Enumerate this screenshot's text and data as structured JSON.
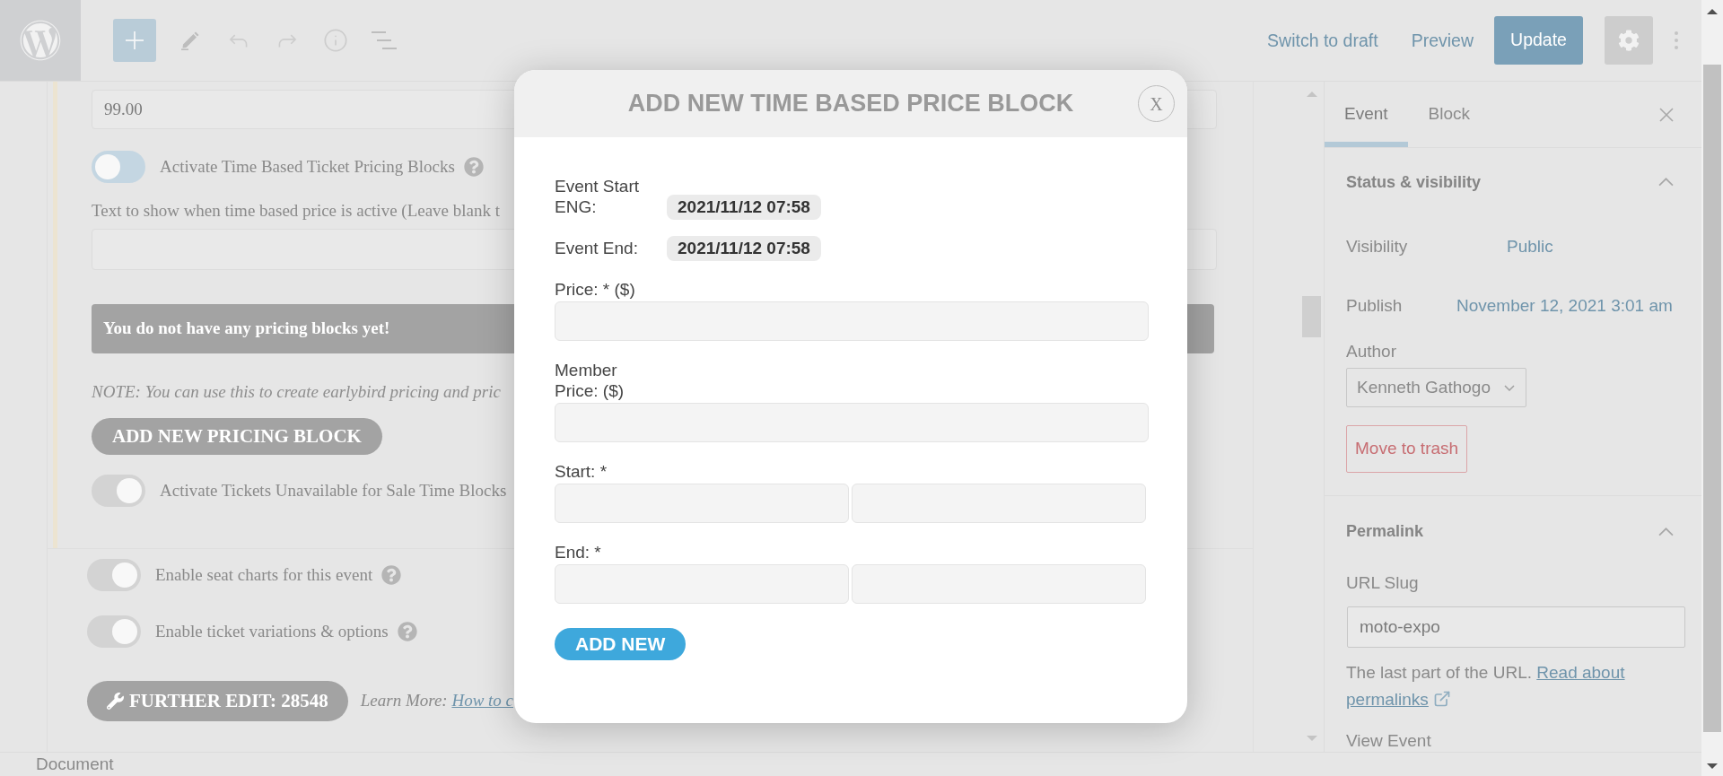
{
  "top_bar": {
    "links": [
      "Switch to draft",
      "Preview"
    ],
    "update_button": "Update"
  },
  "editor": {
    "price_field": {
      "value": "99.00"
    },
    "time_pricing_toggle": {
      "label": "Activate Time Based Ticket Pricing Blocks",
      "on": false,
      "help": true
    },
    "active_text_label": "Text to show when time based price is active (Leave blank t",
    "notice": "You do not have any pricing blocks yet!",
    "note": "NOTE: You can use this to create earlybird pricing and pric",
    "add_block_button": "ADD NEW PRICING BLOCK",
    "unavailable_toggle": {
      "label": "Activate Tickets Unavailable for Sale Time Blocks",
      "on": true,
      "help": false
    },
    "option_toggles": [
      {
        "label": "Enable seat charts for this event",
        "on": true,
        "help": true
      },
      {
        "label": "Enable ticket variations & options",
        "on": true,
        "help": true
      }
    ],
    "further_edit_button": "FURTHER EDIT: 28548",
    "learn_more": {
      "text": "Learn More:",
      "link": "How to c"
    }
  },
  "sidebar": {
    "tabs": [
      {
        "label": "Event",
        "selected": true
      },
      {
        "label": "Block",
        "selected": false
      }
    ],
    "status_panel": {
      "title": "Status & visibility",
      "expanded": true,
      "rows": [
        {
          "label": "Visibility",
          "value": "Public"
        },
        {
          "label": "Publish",
          "value": "November 12, 2021 3:01 am"
        }
      ],
      "author_label": "Author",
      "author": "Kenneth Gathogo",
      "trash_button": "Move to trash"
    },
    "permalink_panel": {
      "title": "Permalink",
      "expanded": true,
      "slug_label": "URL Slug",
      "slug": "moto-expo",
      "help": "The last part of the URL.",
      "help_link": [
        "Read about",
        "permalinks"
      ],
      "view_link": "View Event"
    }
  },
  "footer": {
    "breadcrumb": "Document"
  },
  "modal": {
    "title": "ADD NEW TIME BASED PRICE BLOCK",
    "close": "X",
    "dates": [
      {
        "label": "Event Start ENG:",
        "value": "2021/11/12 07:58"
      },
      {
        "label": "Event End:",
        "value": "2021/11/12 07:58"
      }
    ],
    "fields": [
      {
        "label": "Price: * ($)",
        "kind": "single"
      },
      {
        "label": "Member Price: ($)",
        "kind": "single"
      },
      {
        "label": "Start: *",
        "kind": "pair"
      },
      {
        "label": "End: *",
        "kind": "pair"
      }
    ],
    "submit": "ADD NEW"
  }
}
